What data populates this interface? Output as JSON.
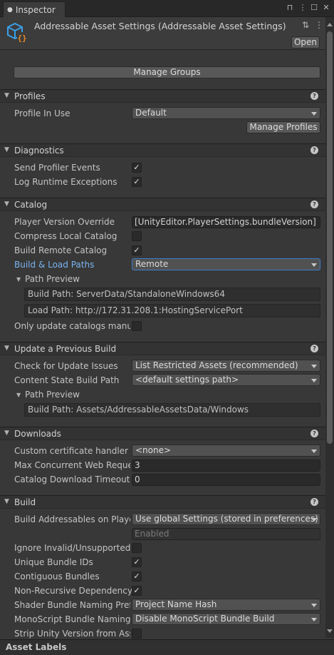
{
  "tab": {
    "title": "Inspector",
    "info_glyph": "❶"
  },
  "header": {
    "title": "Addressable Asset Settings (Addressable Asset Settings)",
    "open_label": "Open",
    "icon": "addressable-settings-icon"
  },
  "manage_groups_label": "Manage Groups",
  "profiles": {
    "title": "Profiles",
    "profile_in_use_label": "Profile In Use",
    "profile_in_use_value": "Default",
    "manage_profiles_label": "Manage Profiles"
  },
  "diagnostics": {
    "title": "Diagnostics",
    "send_profiler_events_label": "Send Profiler Events",
    "send_profiler_events": true,
    "log_runtime_exceptions_label": "Log Runtime Exceptions",
    "log_runtime_exceptions": true
  },
  "catalog": {
    "title": "Catalog",
    "player_version_override_label": "Player Version Override",
    "player_version_override_value": "[UnityEditor.PlayerSettings.bundleVersion]",
    "compress_local_catalog_label": "Compress Local Catalog",
    "compress_local_catalog": false,
    "build_remote_catalog_label": "Build Remote Catalog",
    "build_remote_catalog": true,
    "build_load_paths_label": "Build & Load Paths",
    "build_load_paths_value": "Remote",
    "path_preview_label": "Path Preview",
    "build_path": "Build Path: ServerData/StandaloneWindows64",
    "load_path": "Load Path: http://172.31.208.1:HostingServicePort",
    "only_update_catalogs_label": "Only update catalogs manual",
    "only_update_catalogs": false
  },
  "update_previous_build": {
    "title": "Update a Previous Build",
    "check_for_update_issues_label": "Check for Update Issues",
    "check_for_update_issues_value": "List Restricted Assets (recommended)",
    "content_state_build_path_label": "Content State Build Path",
    "content_state_build_path_value": "<default settings path>",
    "path_preview_label": "Path Preview",
    "build_path": "Build Path: Assets/AddressableAssetsData/Windows"
  },
  "downloads": {
    "title": "Downloads",
    "custom_certificate_handler_label": "Custom certificate handler",
    "custom_certificate_handler_value": "<none>",
    "max_concurrent_label": "Max Concurrent Web Reques",
    "max_concurrent_value": "3",
    "catalog_download_timeout_label": "Catalog Download Timeout",
    "catalog_download_timeout_value": "0"
  },
  "build": {
    "title": "Build",
    "build_addressables_on_player_label": "Build Addressables on Player",
    "build_addressables_on_player_value": "Use global Settings (stored in preferences)",
    "enabled_placeholder": "Enabled",
    "ignore_invalid_label": "Ignore Invalid/Unsupported Fi",
    "ignore_invalid": false,
    "unique_bundle_ids_label": "Unique Bundle IDs",
    "unique_bundle_ids": true,
    "contiguous_bundles_label": "Contiguous Bundles",
    "contiguous_bundles": true,
    "non_recursive_dependency_label": "Non-Recursive Dependency",
    "non_recursive_dependency": true,
    "shader_bundle_naming_label": "Shader Bundle Naming Prefix",
    "shader_bundle_naming_value": "Project Name Hash",
    "monoscript_bundle_naming_label": "MonoScript Bundle Naming P",
    "monoscript_bundle_naming_value": "Disable MonoScript Bundle Build",
    "strip_unity_version_label": "Strip Unity Version from Asse",
    "strip_unity_version": false
  },
  "footer": {
    "title": "Asset Labels"
  },
  "glyphs": {
    "check": "✓",
    "help": "?",
    "expanded": "▼",
    "lock": "🔒",
    "menu": "⋮",
    "maximize": "☐",
    "close": "✕",
    "sliders": "⇅",
    "preset": "⋮"
  },
  "colors": {
    "background": "#383838",
    "link_blue": "#7ab4f0",
    "focus_blue": "#3d7ec8",
    "icon_blue": "#3aa0e8",
    "icon_orange": "#e8892a"
  }
}
